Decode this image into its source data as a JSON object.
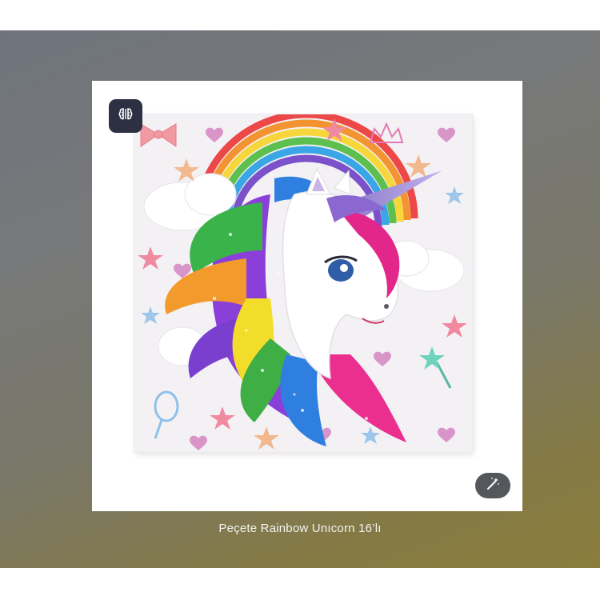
{
  "caption": "Peçete Rainbow Unıcorn 16’lı",
  "icons": {
    "top_left": "brain-icon",
    "bottom_right": "magic-wand-icon"
  },
  "colors": {
    "viewer_top": "#6f747c",
    "viewer_bottom": "#8a7d3c",
    "button_dark": "#2c3042",
    "button_gray": "#54575b"
  }
}
